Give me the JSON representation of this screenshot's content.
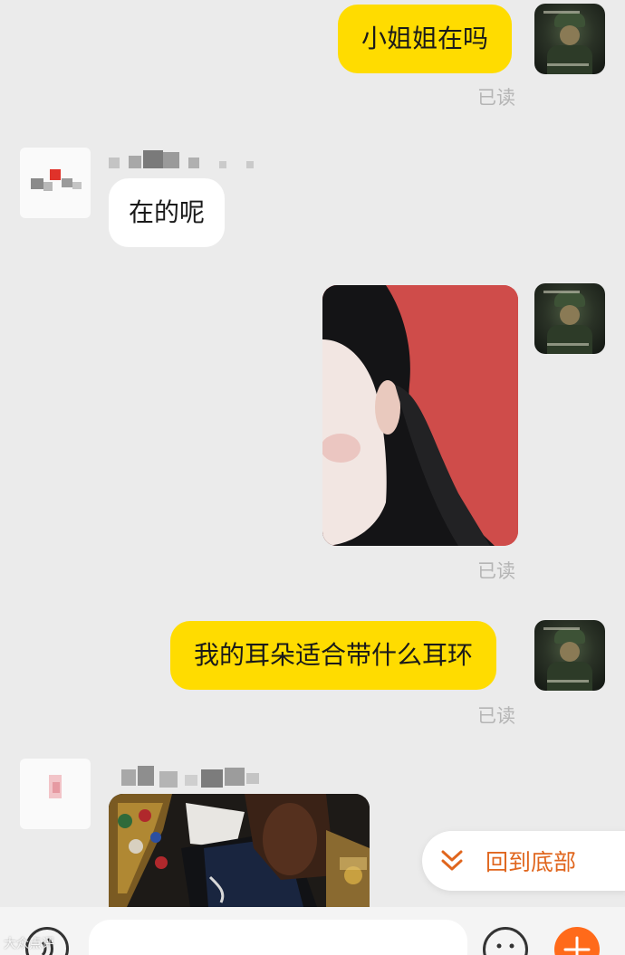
{
  "messages": {
    "m1_text": "小姐姐在吗",
    "m1_status": "已读",
    "m2_text": "在的呢",
    "m3_status": "已读",
    "m4_text": "我的耳朵适合带什么耳环",
    "m4_status": "已读"
  },
  "scroll_to_bottom": {
    "label": "回到底部",
    "icon": "double-chevron-down-icon"
  },
  "input_bar": {
    "voice_icon": "voice-icon",
    "emoji_icon": "emoji-icon",
    "plus_icon": "plus-icon"
  },
  "watermark": "大众点评",
  "colors": {
    "background": "#ebebeb",
    "my_bubble": "#ffdc00",
    "their_bubble": "#ffffff",
    "read_status": "#b5b5b5",
    "accent_orange": "#e0661e",
    "plus_button": "#ff6a1a"
  }
}
